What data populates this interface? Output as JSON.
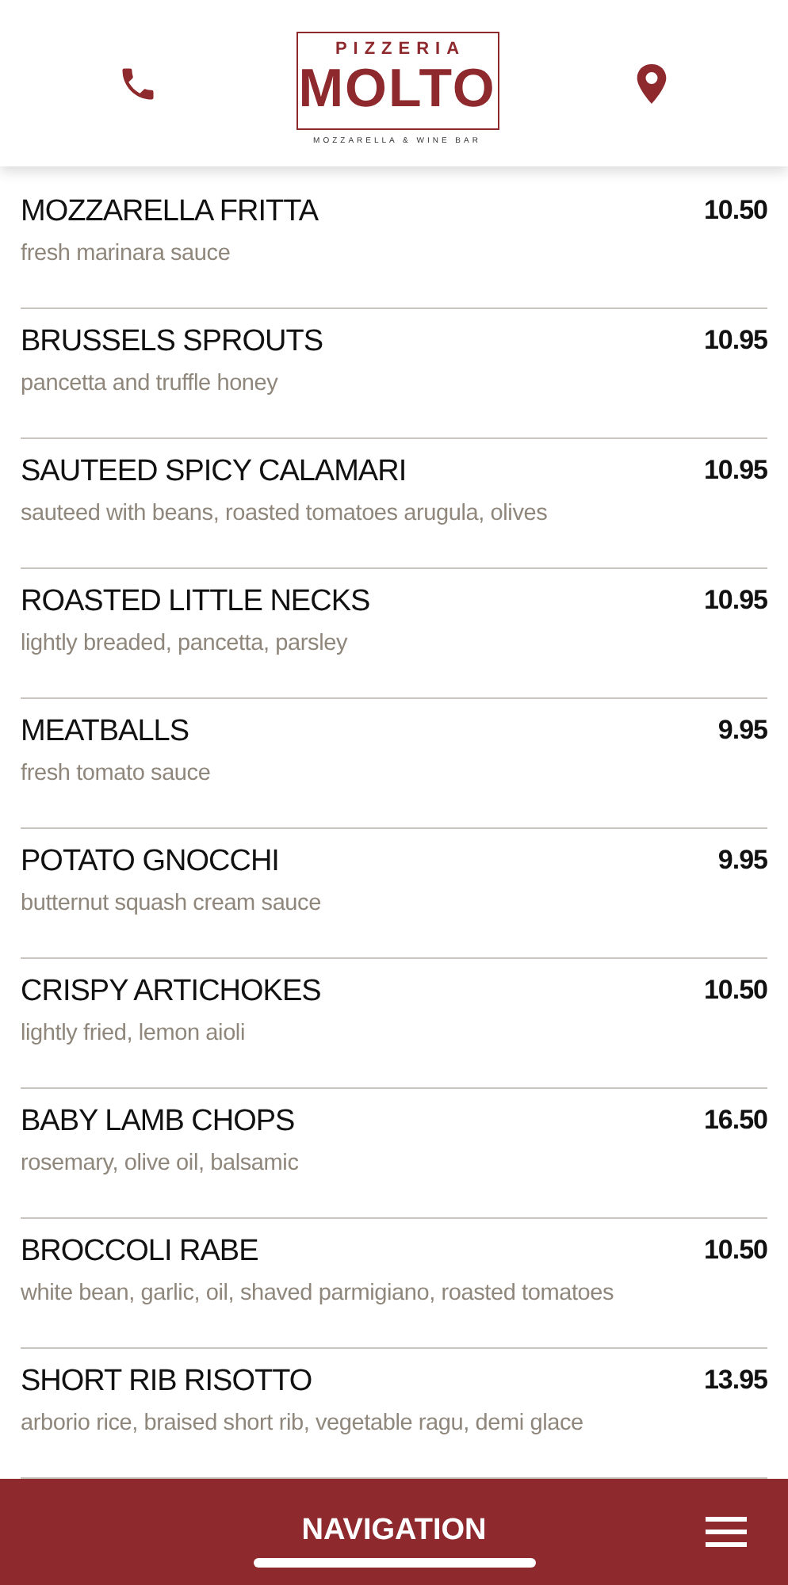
{
  "header": {
    "logo": {
      "top": "PIZZERIA",
      "name": "MOLTO",
      "tagline": "MOZZARELLA & WINE BAR"
    }
  },
  "menu_items": [
    {
      "name": "MOZZARELLA FRITTA",
      "description": "fresh marinara sauce",
      "price": "10.50"
    },
    {
      "name": "BRUSSELS SPROUTS",
      "description": "pancetta and truffle honey",
      "price": "10.95"
    },
    {
      "name": "SAUTEED SPICY CALAMARI",
      "description": "sauteed with beans, roasted tomatoes arugula, olives",
      "price": "10.95"
    },
    {
      "name": "ROASTED LITTLE NECKS",
      "description": "lightly breaded, pancetta, parsley",
      "price": "10.95"
    },
    {
      "name": "MEATBALLS",
      "description": "fresh tomato sauce",
      "price": "9.95"
    },
    {
      "name": "POTATO GNOCCHI",
      "description": "butternut squash cream sauce",
      "price": "9.95"
    },
    {
      "name": "CRISPY ARTICHOKES",
      "description": "lightly fried, lemon aioli",
      "price": "10.50"
    },
    {
      "name": "BABY LAMB CHOPS",
      "description": "rosemary, olive oil, balsamic",
      "price": "16.50"
    },
    {
      "name": "BROCCOLI RABE",
      "description": "white bean, garlic, oil, shaved parmigiano, roasted tomatoes",
      "price": "10.50"
    },
    {
      "name": "SHORT RIB RISOTTO",
      "description": "arborio rice, braised short rib, vegetable ragu, demi glace",
      "price": "13.95"
    }
  ],
  "bottom_bar": {
    "label": "NAVIGATION"
  }
}
